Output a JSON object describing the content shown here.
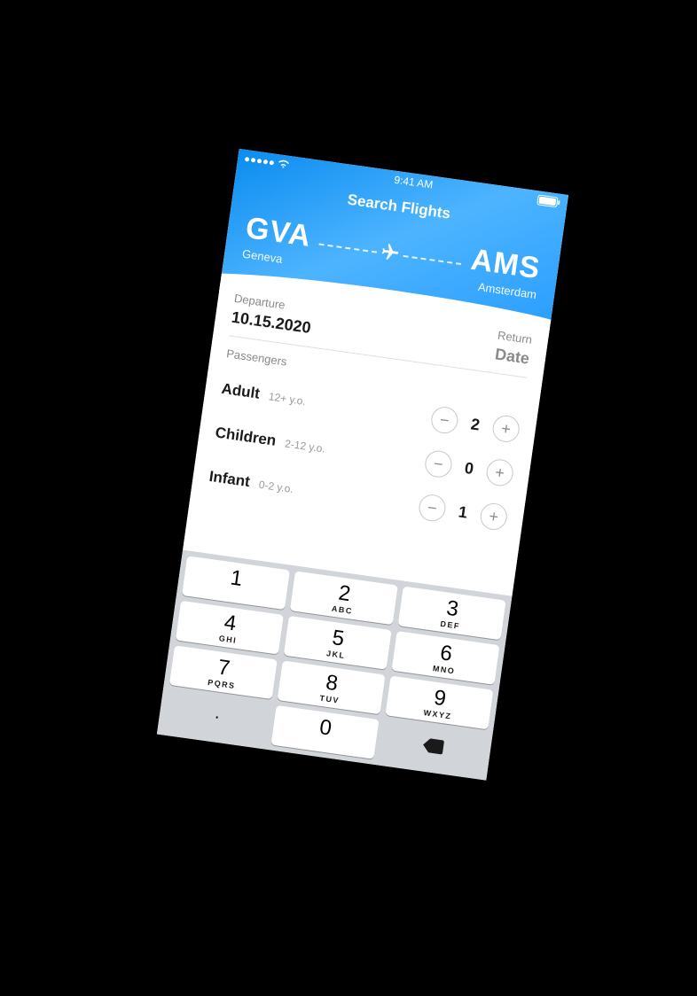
{
  "status": {
    "time": "9:41 AM"
  },
  "header": {
    "title": "Search Flights",
    "origin": {
      "code": "GVA",
      "city": "Geneva"
    },
    "destination": {
      "code": "AMS",
      "city": "Amsterdam"
    }
  },
  "dates": {
    "departure_label": "Departure",
    "departure_value": "10.15.2020",
    "return_label": "Return",
    "return_value": "Date"
  },
  "passengers": {
    "section_label": "Passengers",
    "rows": [
      {
        "label": "Adult",
        "sub": "12+ y.o.",
        "value": "2"
      },
      {
        "label": "Children",
        "sub": "2-12 y.o.",
        "value": "0"
      },
      {
        "label": "Infant",
        "sub": "0-2 y.o.",
        "value": "1"
      }
    ]
  },
  "keyboard": {
    "keys": {
      "k1": {
        "num": "1",
        "sub": ""
      },
      "k2": {
        "num": "2",
        "sub": "ABC"
      },
      "k3": {
        "num": "3",
        "sub": "DEF"
      },
      "k4": {
        "num": "4",
        "sub": "GHI"
      },
      "k5": {
        "num": "5",
        "sub": "JKL"
      },
      "k6": {
        "num": "6",
        "sub": "MNO"
      },
      "k7": {
        "num": "7",
        "sub": "PQRS"
      },
      "k8": {
        "num": "8",
        "sub": "TUV"
      },
      "k9": {
        "num": "9",
        "sub": "WXYZ"
      },
      "k0": {
        "num": "0",
        "sub": ""
      },
      "period": {
        "num": ".",
        "sub": ""
      }
    }
  }
}
